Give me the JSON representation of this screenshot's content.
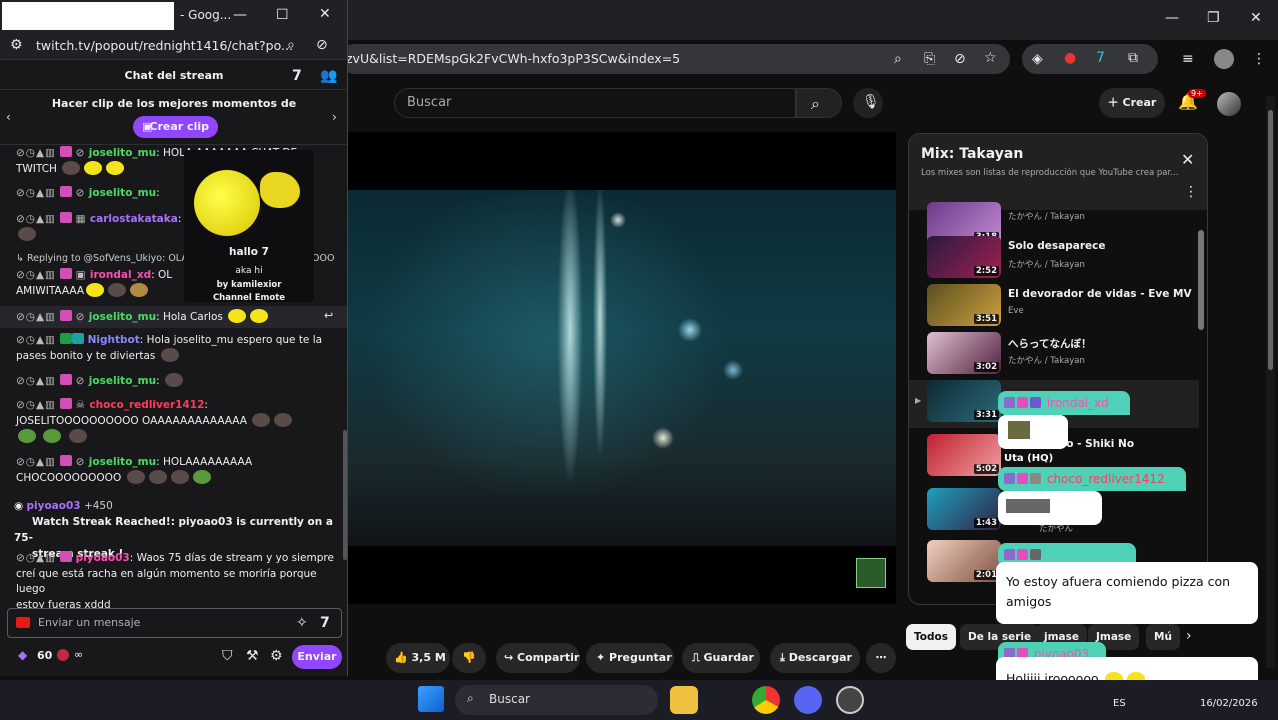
{
  "youtube": {
    "address": "zvU&list=RDEMspGk2FvCWh-hxfo3pP3SCw&index=5",
    "search_placeholder": "Buscar",
    "create_label": "Crear",
    "notif_count": "9+",
    "actions": {
      "likes": "3,5 M",
      "share": "Compartir",
      "ask": "Preguntar",
      "save": "Guardar",
      "download": "Descargar"
    },
    "playlist": {
      "title": "Mix: Takayan",
      "subtitle": "Los mixes son listas de reproducción que YouTube crea par...",
      "items": [
        {
          "title": "",
          "channel": "たかやん / Takayan",
          "duration": "3:18"
        },
        {
          "title": "Solo desaparece",
          "channel": "たかやん / Takayan",
          "duration": "2:52"
        },
        {
          "title": "El devorador de vidas - Eve MV",
          "channel": "Eve",
          "duration": "3:51"
        },
        {
          "title": "へらってなんぼ！",
          "channel": "たかやん / Takayan",
          "duration": "3:02"
        },
        {
          "title": "",
          "channel": "",
          "duration": "3:31"
        },
        {
          "title": "mploo - Shiki No",
          "channel": "",
          "duration": "5:02"
        },
        {
          "title": "",
          "channel": "たかやん",
          "duration": "1:43"
        },
        {
          "title": "",
          "channel": "",
          "duration": "2:01"
        }
      ]
    },
    "chips": [
      "Todos",
      "De la serie",
      "jmase",
      "Jmase",
      "Mú"
    ]
  },
  "chat": {
    "window_title": "- Goog...",
    "url": "twitch.tv/popout/rednight1416/chat?po...",
    "header": "Chat del stream",
    "clip_prompt": "Hacer clip de los mejores momentos de",
    "clip_button": "Crear clip",
    "messages": [
      {
        "user": "joselito_mu",
        "text": ": HOLA AAAAAAA CHAT DE",
        "cont": "TWITCH"
      },
      {
        "user": "joselito_mu",
        "text": ":"
      },
      {
        "user": "carlostakataka",
        "text": ":"
      },
      {
        "reply": "Replying to @SofVens_Ukiyo: OLAA",
        "tail": "OOO"
      },
      {
        "user": "irondal_xd",
        "text": ": OL",
        "cont": "AMIWITAAAA"
      },
      {
        "user": "joselito_mu",
        "text": ": Hola Carlos"
      },
      {
        "user": "Nightbot",
        "text": ": Hola joselito_mu espero que te la",
        "cont": "pases bonito y te diviertas"
      },
      {
        "user": "joselito_mu",
        "text": ":"
      },
      {
        "user": "choco_redliver1412",
        "text": ":",
        "cont": "JOSELITOOOOOOOOOO OAAAAAAAAAAAAA"
      },
      {
        "user": "joselito_mu",
        "text": ": HOLAAAAAAAAA",
        "cont": "CHOCOOOOOOOOO"
      }
    ],
    "streak": {
      "user": "piyoao03",
      "points": "+450",
      "title": "Watch Streak Reached!:",
      "text": " piyoao03 is currently on a 75-",
      "cont": "stream streak !"
    },
    "last_msg": {
      "user": "piyoao03",
      "text": ": Waos 75 días de stream y yo siempre",
      "cont1": "creí que está racha en algún momento se moriría porque luego",
      "cont2": "estoy fueras xddd"
    },
    "popup": {
      "name": "hallo",
      "alias": "aka hi",
      "by": "by kamilexior",
      "type": "Channel Emote"
    },
    "input_placeholder": "Enviar un mensaje",
    "points": "60",
    "infinity": "∞",
    "send": "Enviar"
  },
  "overlay": [
    {
      "user": "irondal_xd",
      "text": ""
    },
    {
      "user": "",
      "text": "Uta (HQ)"
    },
    {
      "user": "choco_redliver1412",
      "text": ""
    },
    {
      "user": "",
      "text": "Yo estoy afuera comiendo pizza con amigos"
    },
    {
      "user": "piyoao03",
      "text": "Holiiii iroooooo"
    }
  ],
  "taskbar": {
    "search": "Buscar",
    "lang": "ES",
    "date": "16/02/2026"
  }
}
